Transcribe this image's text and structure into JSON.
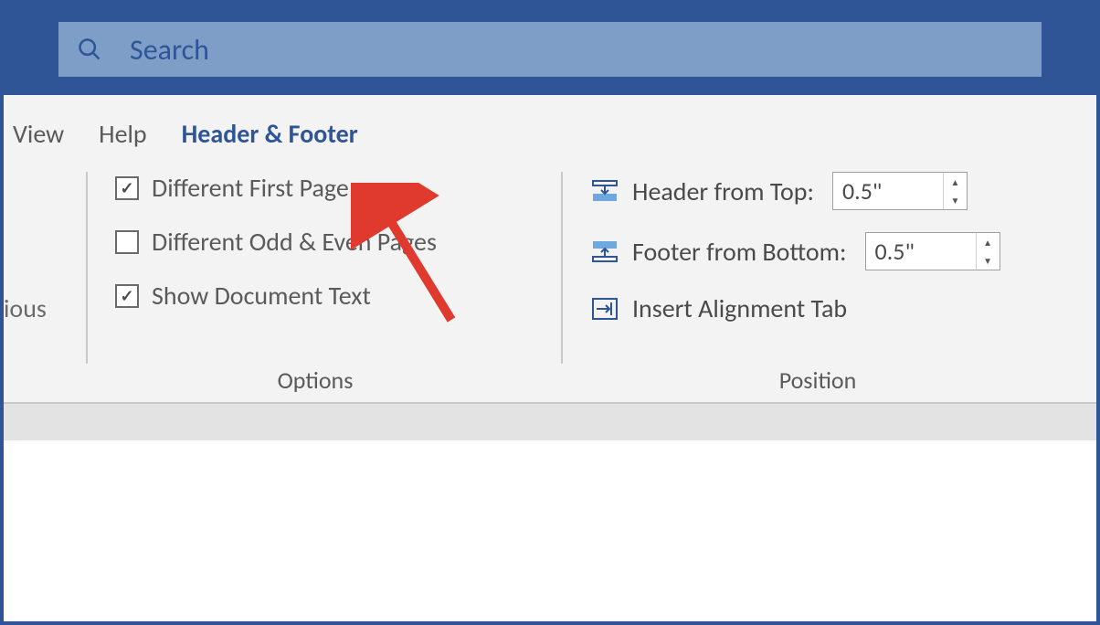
{
  "search": {
    "placeholder": "Search"
  },
  "tabs": {
    "view": "View",
    "help": "Help",
    "headerFooter": "Header & Footer"
  },
  "leftCut": "ious",
  "options": {
    "differentFirstPage": {
      "label": "Different First Page",
      "checked": true
    },
    "differentOddEven": {
      "label": "Different Odd & Even Pages",
      "checked": false
    },
    "showDocumentText": {
      "label": "Show Document Text",
      "checked": true
    },
    "groupLabel": "Options"
  },
  "position": {
    "headerFromTop": {
      "label": "Header from Top:",
      "value": "0.5\""
    },
    "footerFromBottom": {
      "label": "Footer from Bottom:",
      "value": "0.5\""
    },
    "insertAlignTab": {
      "label": "Insert Alignment Tab"
    },
    "groupLabel": "Position"
  }
}
